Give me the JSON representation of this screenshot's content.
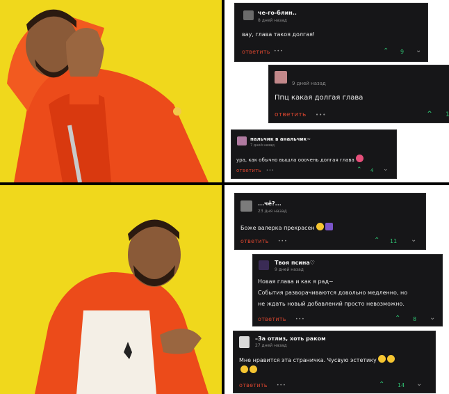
{
  "colors": {
    "photo_bg": "#f0d81c",
    "card_bg": "#161618",
    "reply": "#d8452f",
    "upvote": "#2fbf71",
    "divider": "#000000"
  },
  "top_comments": [
    {
      "name": "чe-го-блин..",
      "time": "8 дней назад",
      "body": "вау, глава такоя долгая!",
      "reply": "ответить",
      "dots": "•••",
      "count": "9"
    },
    {
      "name": "",
      "time": "9 дней назад",
      "body": "Ппц какая долгая глава",
      "reply": "ответить",
      "dots": "•••",
      "count": "1"
    },
    {
      "name": "пальчик в анальчик~",
      "time": "7 дней назад",
      "body": "ура, как обычно вышла ооочень долгая глава",
      "reply": "ответить",
      "dots": "•••",
      "count": "4"
    }
  ],
  "bottom_comments": [
    {
      "name": "...чё?...",
      "time": "23 дня назад",
      "body": "Боже валерка прекрасен",
      "reply": "ответить",
      "dots": "•••",
      "count": "11"
    },
    {
      "name": "Твоя псина♡",
      "time": "9 дней назад",
      "body": "Новая глава и как я рад~",
      "body2": "События разворачиваются довольно медленно, но",
      "body3": "не ждать новый добавлений просто невозможно.",
      "reply": "ответить",
      "dots": "•••",
      "count": "8"
    },
    {
      "name": "–За отлиз, хоть раком",
      "time": "27 дней назад",
      "body": "Мне нравится эта страничка. Чусвую эстетику",
      "reply": "ответить",
      "dots": "•••",
      "count": "14"
    }
  ],
  "icons": {
    "upvote": "chevron-up-icon",
    "downvote": "chevron-down-icon",
    "more": "more-dots-icon"
  }
}
